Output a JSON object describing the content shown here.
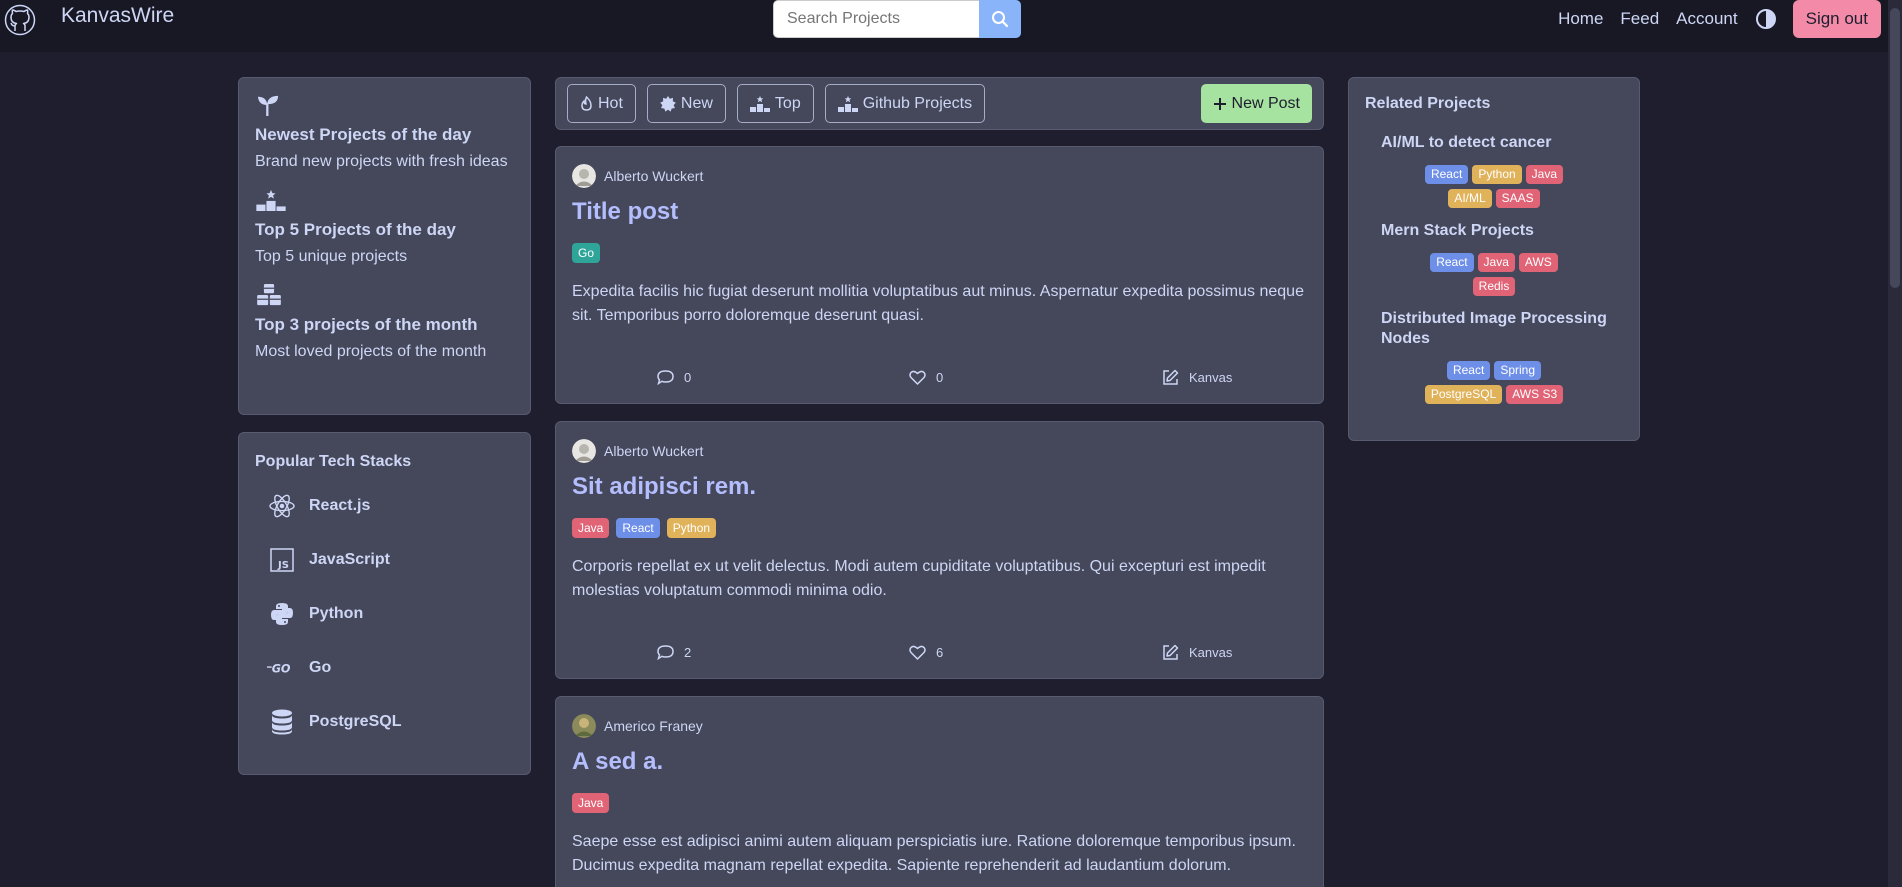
{
  "nav": {
    "brand": "KanvasWire",
    "search_placeholder": "Search Projects",
    "links": [
      "Home",
      "Feed",
      "Account"
    ],
    "signout": "Sign out"
  },
  "left_highlights": [
    {
      "icon": "seedling-icon",
      "title": "Newest Projects of the day",
      "subtitle": "Brand new projects with fresh ideas"
    },
    {
      "icon": "ranking-star-icon",
      "title": "Top 5 Projects of the day",
      "subtitle": "Top 5 unique projects"
    },
    {
      "icon": "cubes-icon",
      "title": "Top 3 projects of the month",
      "subtitle": "Most loved projects of the month"
    }
  ],
  "tech_stacks": {
    "title": "Popular Tech Stacks",
    "items": [
      {
        "icon": "react-icon",
        "label": "React.js"
      },
      {
        "icon": "js-icon",
        "label": "JavaScript"
      },
      {
        "icon": "python-icon",
        "label": "Python"
      },
      {
        "icon": "go-icon",
        "label": "Go"
      },
      {
        "icon": "database-icon",
        "label": "PostgreSQL"
      }
    ]
  },
  "feed_filters": [
    "Hot",
    "New",
    "Top",
    "Github Projects"
  ],
  "new_post_label": "New Post",
  "tag_colors": {
    "Go": "#2fa59a",
    "Java": "#e06476",
    "React": "#6d8fe8",
    "Python": "#e0b25a",
    "AI/ML": "#e0b25a",
    "SAAS": "#e06476",
    "AWS": "#e06476",
    "Redis": "#e06476",
    "Spring": "#6d8fe8",
    "PostgreSQL": "#e0b25a",
    "AWS S3": "#e06476"
  },
  "posts": [
    {
      "author": "Alberto Wuckert",
      "title": "Title post",
      "tags": [
        "Go"
      ],
      "body": "Expedita facilis hic fugiat deserunt mollitia voluptatibus aut minus. Aspernatur expedita possimus neque sit. Temporibus porro doloremque deserunt quasi.",
      "comments": "0",
      "likes": "0",
      "platform": "Kanvas"
    },
    {
      "author": "Alberto Wuckert",
      "title": "Sit adipisci rem.",
      "tags": [
        "Java",
        "React",
        "Python"
      ],
      "body": "Corporis repellat ex ut velit delectus. Modi autem cupiditate voluptatibus. Qui excepturi est impedit molestias voluptatum commodi minima odio.",
      "comments": "2",
      "likes": "6",
      "platform": "Kanvas"
    },
    {
      "author": "Americo Franey",
      "title": "A sed a.",
      "tags": [
        "Java"
      ],
      "body": "Saepe esse est adipisci animi autem aliquam perspiciatis iure. Ratione doloremque temporibus ipsum. Ducimus expedita magnam repellat expedita. Sapiente reprehenderit ad laudantium dolorum.",
      "comments": "",
      "likes": "",
      "platform": ""
    }
  ],
  "related": {
    "heading": "Related Projects",
    "items": [
      {
        "title": "AI/ML to detect cancer",
        "tags": [
          "React",
          "Python",
          "Java",
          "AI/ML",
          "SAAS"
        ]
      },
      {
        "title": "Mern Stack Projects",
        "tags": [
          "React",
          "Java",
          "AWS",
          "Redis"
        ]
      },
      {
        "title": "Distributed Image Processing Nodes",
        "tags": [
          "React",
          "Spring",
          "PostgreSQL",
          "AWS S3"
        ]
      }
    ]
  }
}
